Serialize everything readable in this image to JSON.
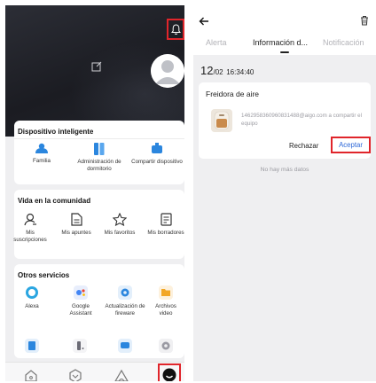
{
  "left_screen": {
    "icons": {
      "bell": "bell-icon",
      "edit": "edit-icon",
      "avatar": "avatar-icon"
    },
    "highlight_color": "#e0252b",
    "smart_device": {
      "title": "Dispositivo inteligente",
      "items": [
        {
          "label": "Familia",
          "icon": "family-icon",
          "color": "#2b86de"
        },
        {
          "label": "Administración de dormitorio",
          "icon": "room-management-icon",
          "color": "#2b86de"
        },
        {
          "label": "Compartir dispositivo",
          "icon": "share-device-icon",
          "color": "#2b86de"
        }
      ]
    },
    "community": {
      "title": "Vida en la comunidad",
      "items": [
        {
          "label": "Mis suscripciones",
          "icon": "subscriptions-icon"
        },
        {
          "label": "Mis apuntes",
          "icon": "notes-icon"
        },
        {
          "label": "Mis favoritos",
          "icon": "star-icon"
        },
        {
          "label": "Mis borradores",
          "icon": "drafts-icon"
        }
      ]
    },
    "other_services": {
      "title": "Otros servicios",
      "items": [
        {
          "label": "Alexa",
          "icon": "alexa-icon"
        },
        {
          "label": "Google Assistant",
          "icon": "google-assistant-icon"
        },
        {
          "label": "Actualización de fireware",
          "icon": "firmware-update-icon"
        },
        {
          "label": "Archivos video",
          "icon": "video-files-icon"
        }
      ],
      "more_icons": [
        "faq-icon",
        "device-icon",
        "sms-icon",
        "settings-icon"
      ]
    },
    "tabbar": [
      "home-tab-icon",
      "smart-tab-icon",
      "community-tab-icon",
      "me-tab-icon"
    ]
  },
  "right_screen": {
    "tabs": [
      {
        "label": "Alerta",
        "active": false
      },
      {
        "label": "Información d...",
        "active": true
      },
      {
        "label": "Notificación",
        "active": false
      }
    ],
    "date": {
      "day": "12",
      "month": "/02",
      "time": "16:34:40"
    },
    "message": {
      "title": "Freidora de aire",
      "body": "1462958360960831488@aigo.com a compartir el equipo",
      "reject_label": "Rechazar",
      "accept_label": "Aceptar",
      "accent_color": "#2d68d8"
    },
    "empty_text": "No hay más datos"
  }
}
